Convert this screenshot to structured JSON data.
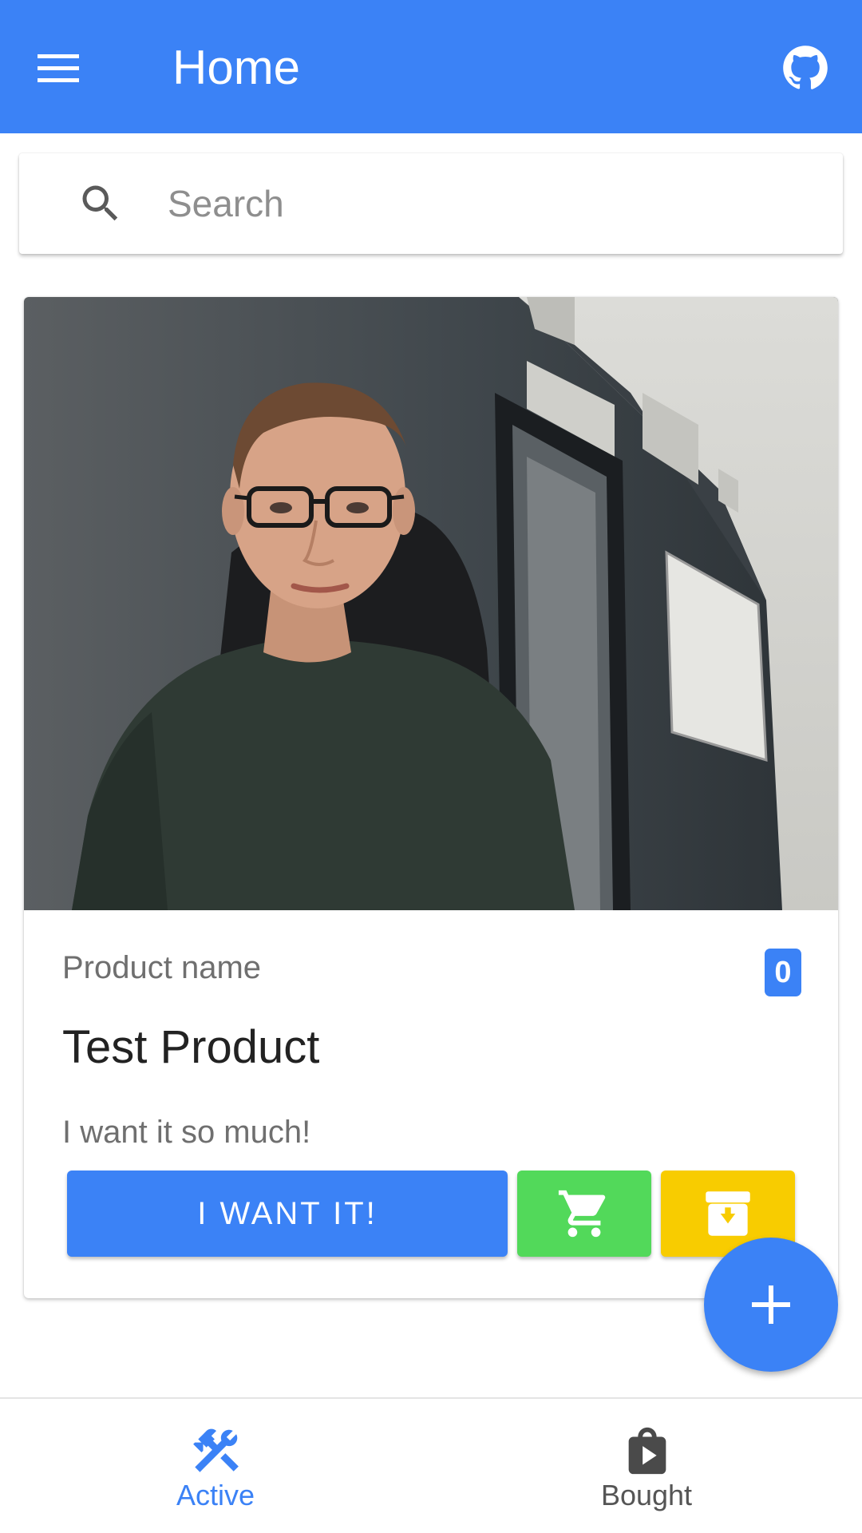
{
  "app_bar": {
    "title": "Home",
    "menu_icon": "hamburger-menu-icon",
    "github_icon": "github-icon",
    "color": "#3b82f6"
  },
  "search": {
    "placeholder": "Search",
    "value": "",
    "icon": "search-icon"
  },
  "product_card": {
    "label": "Product name",
    "count": "0",
    "title": "Test Product",
    "description": "I want it so much!",
    "photo": "photo of a man with glasses in a dark green t-shirt sitting in an office",
    "want_button_label": "I WANT IT!",
    "cart_icon": "shopping-cart-icon",
    "archive_icon": "archive-down-icon"
  },
  "fab": {
    "icon": "plus-icon"
  },
  "bottom_nav": {
    "items": [
      {
        "label": "Active",
        "icon": "tools-icon",
        "selected": true
      },
      {
        "label": "Bought",
        "icon": "shopping-bag-icon",
        "selected": false
      }
    ]
  },
  "colors": {
    "primary": "#3b82f6",
    "cart": "#52d95a",
    "archive": "#f8cc00"
  }
}
